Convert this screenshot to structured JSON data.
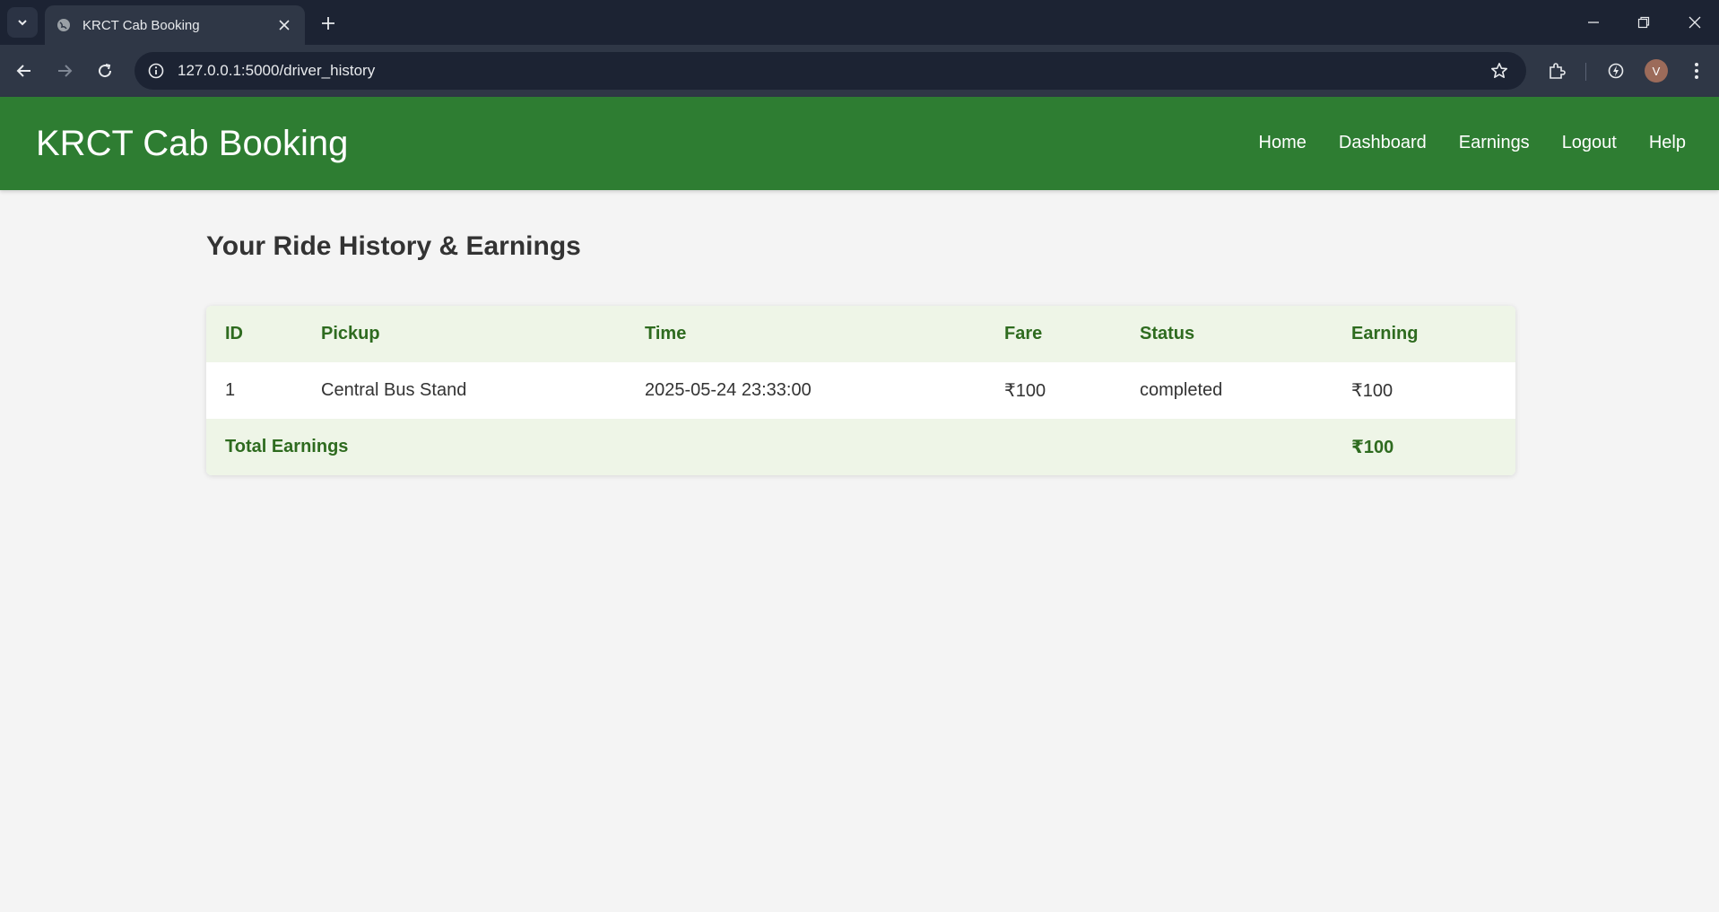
{
  "browser": {
    "tab_title": "KRCT Cab Booking",
    "url": "127.0.0.1:5000/driver_history",
    "profile_initial": "V",
    "icons": [
      "tab-search-icon",
      "globe-icon",
      "close-icon",
      "plus-icon",
      "minimize-icon",
      "restore-icon",
      "window-close-icon",
      "back-icon",
      "forward-icon",
      "reload-icon",
      "info-icon",
      "star-icon",
      "extensions-icon",
      "performance-icon",
      "more-icon"
    ]
  },
  "header": {
    "title": "KRCT Cab Booking",
    "nav": [
      {
        "label": "Home"
      },
      {
        "label": "Dashboard"
      },
      {
        "label": "Earnings"
      },
      {
        "label": "Logout"
      },
      {
        "label": "Help"
      }
    ]
  },
  "page": {
    "heading": "Your Ride History & Earnings"
  },
  "table": {
    "columns": [
      "ID",
      "Pickup",
      "Time",
      "Fare",
      "Status",
      "Earning"
    ],
    "rows": [
      {
        "id": "1",
        "pickup": "Central Bus Stand",
        "time": "2025-05-24 23:33:00",
        "fare": "₹100",
        "status": "completed",
        "earning": "₹100"
      }
    ],
    "total_label": "Total Earnings",
    "total_value": "₹100"
  },
  "colors": {
    "header_green": "#2e7d32",
    "table_header_bg": "#eef5e7",
    "table_header_text": "#2e6b1f",
    "page_bg": "#f4f4f4"
  }
}
